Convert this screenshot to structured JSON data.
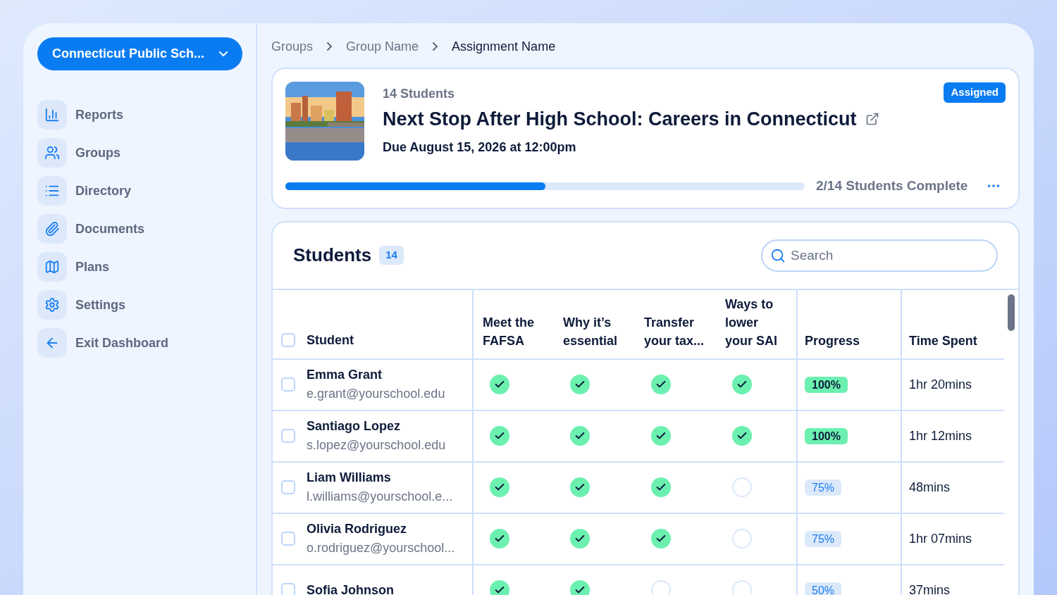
{
  "sidebar": {
    "org_selector": "Connecticut Public Sch...",
    "items": [
      {
        "label": "Reports"
      },
      {
        "label": "Groups"
      },
      {
        "label": "Directory"
      },
      {
        "label": "Documents"
      },
      {
        "label": "Plans"
      },
      {
        "label": "Settings"
      },
      {
        "label": "Exit Dashboard"
      }
    ]
  },
  "breadcrumbs": [
    {
      "label": "Groups",
      "current": false
    },
    {
      "label": "Group Name",
      "current": false
    },
    {
      "label": "Assignment Name",
      "current": true
    }
  ],
  "assignment": {
    "count": "14 Students",
    "title": "Next Stop After High School: Careers in Connecticut",
    "due": "Due August 15, 2026 at 12:00pm",
    "status": "Assigned",
    "level": 0.5,
    "progress_text": "2/14 Students Complete"
  },
  "students": {
    "title": "Students",
    "count": "14",
    "select_all_checked": false,
    "search": {
      "placeholder": "Search"
    },
    "columns": [
      "Student",
      "Meet the FAFSA",
      "Why it’s essential",
      "Transfer your tax...",
      "Ways to lower your SAI",
      "Progress",
      "Time Spent"
    ],
    "rows": [
      {
        "checked": false,
        "name": "Emma Grant",
        "email": "e.grant@yourschool.edu",
        "tasks": [
          true,
          true,
          true,
          true
        ],
        "progress": "100%",
        "complete": true,
        "time": "1hr 20mins"
      },
      {
        "checked": false,
        "name": "Santiago Lopez",
        "email": "s.lopez@yourschool.edu",
        "tasks": [
          true,
          true,
          true,
          true
        ],
        "progress": "100%",
        "complete": true,
        "time": "1hr 12mins"
      },
      {
        "checked": false,
        "name": "Liam Williams",
        "email": "l.williams@yourschool.e...",
        "tasks": [
          true,
          true,
          true,
          false
        ],
        "progress": "75%",
        "complete": false,
        "time": "48mins"
      },
      {
        "checked": false,
        "name": "Olivia Rodriguez",
        "email": "o.rodriguez@yourschool...",
        "tasks": [
          true,
          true,
          true,
          false
        ],
        "progress": "75%",
        "complete": false,
        "time": "1hr 07mins"
      },
      {
        "checked": false,
        "name": "Sofia Johnson",
        "tasks": [
          true,
          true,
          false,
          false
        ],
        "progress": "50%",
        "complete": false,
        "time": "37mins"
      }
    ]
  }
}
